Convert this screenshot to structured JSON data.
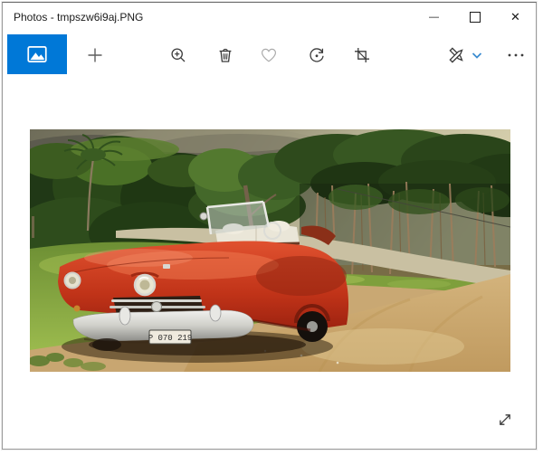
{
  "window": {
    "title": "Photos - tmpszw6i9aj.PNG"
  },
  "titlebar": {
    "minimize_glyph": "—",
    "close_glyph": "✕"
  },
  "toolbar": {
    "app_button": "photos-collection-tile",
    "buttons": [
      "add",
      "zoom",
      "delete",
      "favorite",
      "rotate",
      "crop",
      "edit-create",
      "see-more"
    ]
  },
  "icons": {
    "app_tile": "image-mountain-icon",
    "add": "plus",
    "zoom": "magnifier-plus",
    "delete": "trash-can",
    "favorite": "heart-outline",
    "rotate": "circular-arrow",
    "crop": "crop-frame",
    "edit_create": "crossed-pencils",
    "edit_chevron": "chevron-down",
    "see_more": "ellipsis",
    "expand": "diagonal-resize-arrows",
    "minimize": "dash",
    "maximize": "square-outline",
    "close": "x"
  },
  "photo": {
    "license_plate": "P 070 219",
    "description": "Red vintage convertible parked on a dirt road beside a green meadow, palm and tropical trees under a cloudy sky"
  },
  "colors": {
    "accent": "#0078d7",
    "chevron_blue": "#3a8bd0",
    "icon_dark": "#3b3b3b",
    "heart_gray": "#ababab",
    "titlebar_bg": "#ffffff"
  }
}
